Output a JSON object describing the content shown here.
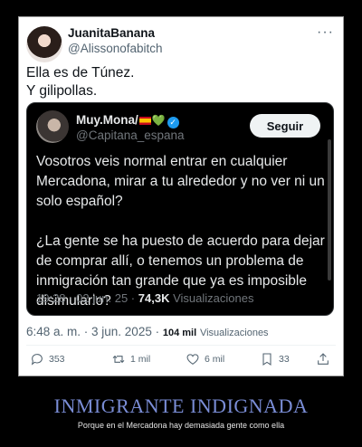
{
  "tweet": {
    "name": "JuanitaBanana",
    "handle": "@Alissonofabitch",
    "more_glyph": "···",
    "lines": [
      "Ella es de Túnez.",
      "Y gilipollas."
    ],
    "date": "6:48 a. m. · 3 jun. 2025 ·",
    "views_count": "104 mil",
    "views_label": "Visualizaciones"
  },
  "quoted": {
    "name": "Muy.Mona/",
    "heart": "💚",
    "verified_glyph": "✓",
    "handle": "@Capitana_espana",
    "follow_label": "Seguir",
    "para1": [
      "Vosotros veis normal entrar en cualquier",
      "Mercadona, mirar a tu alrededor y no ver ni un",
      "solo español?"
    ],
    "para2": [
      "¿La gente se ha puesto de acuerdo para dejar",
      "de comprar allí, o tenemos un problema de",
      "inmigración tan grande que ya es imposible",
      "disimularlo?"
    ],
    "date": "19:28 · 02 jun. 25 ·",
    "views_count": "74,3K",
    "views_label": "Visualizaciones"
  },
  "actions": {
    "replies": "353",
    "retweets": "1 mil",
    "likes": "6 mil",
    "bookmarks": "33"
  },
  "caption": {
    "title": "INMIGRANTE INDIGNADA",
    "subtitle": "Porque en el Mercadona hay demasiada gente como ella"
  },
  "icons": {
    "reply": "reply-icon",
    "retweet": "retweet-icon",
    "like": "heart-icon",
    "bookmark": "bookmark-icon",
    "share": "share-icon"
  },
  "colors": {
    "caption_title": "#7a8dd6",
    "verified": "#1d9bf0",
    "heart": "#3bb54a"
  }
}
